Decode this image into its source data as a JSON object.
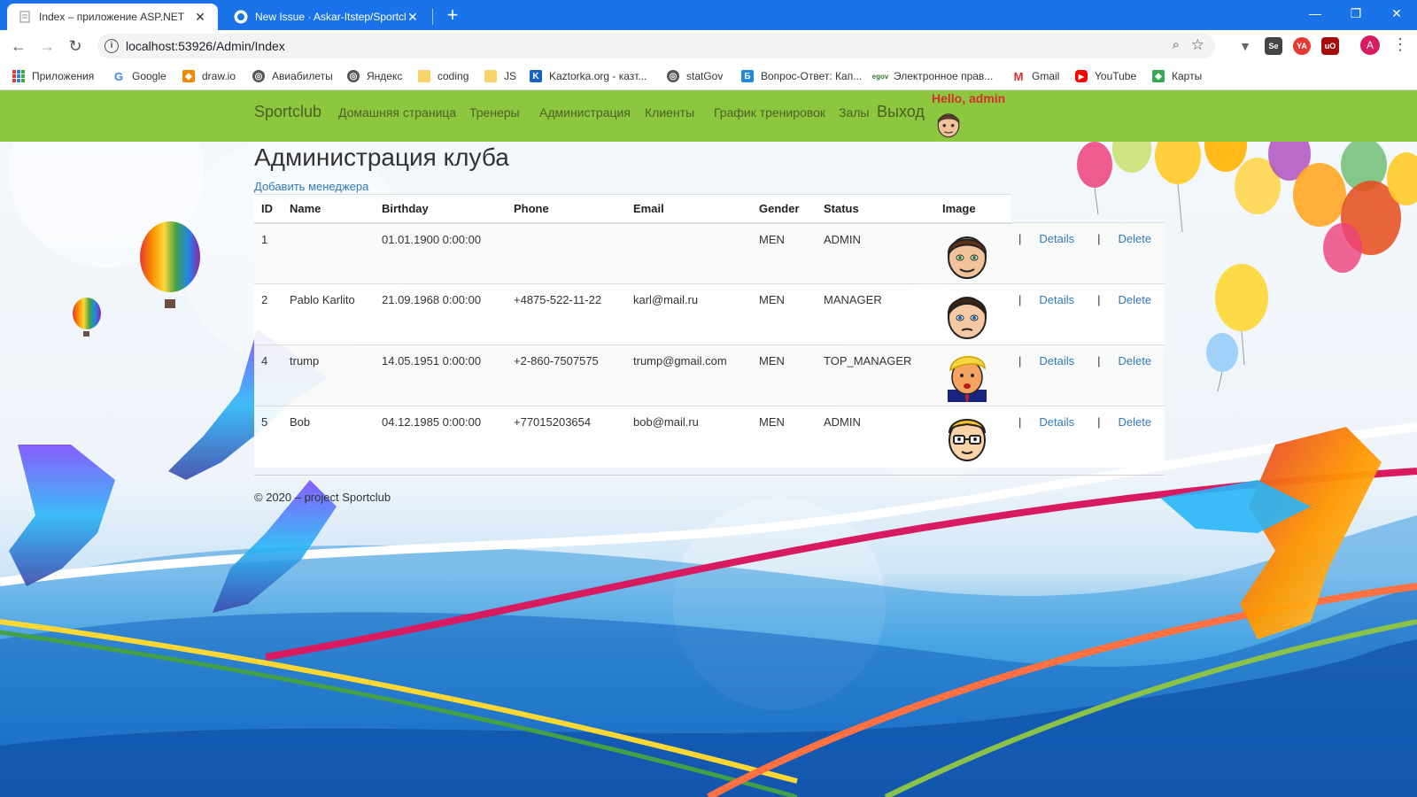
{
  "browser": {
    "tabs": [
      {
        "title": "Index – приложение ASP.NET",
        "active": true
      },
      {
        "title": "New Issue · Askar-Itstep/Sportclub",
        "active": false
      }
    ],
    "url": "localhost:53926/Admin/Index",
    "profile_initial": "A",
    "bookmarks": [
      {
        "label": "Приложения",
        "icon": "apps-grid-icon"
      },
      {
        "label": "Google",
        "icon": "google-icon"
      },
      {
        "label": "draw.io",
        "icon": "drawio-icon"
      },
      {
        "label": "Авиабилеты",
        "icon": "globe-icon"
      },
      {
        "label": "Яндекс",
        "icon": "globe-icon"
      },
      {
        "label": "coding",
        "icon": "folder-icon"
      },
      {
        "label": "JS",
        "icon": "folder-icon"
      },
      {
        "label": "Kaztorka.org - казт...",
        "icon": "kaztorka-icon"
      },
      {
        "label": "statGov",
        "icon": "globe-icon"
      },
      {
        "label": "Вопрос-Ответ: Кап...",
        "icon": "b-icon"
      },
      {
        "label": "Электронное прав...",
        "icon": "egov-icon"
      },
      {
        "label": "Gmail",
        "icon": "gmail-icon"
      },
      {
        "label": "YouTube",
        "icon": "youtube-icon"
      },
      {
        "label": "Карты",
        "icon": "maps-icon"
      }
    ]
  },
  "site": {
    "brand": "Sportclub",
    "nav": [
      "Домашняя страница",
      "Тренеры",
      "Администрация",
      "Клиенты",
      "График тренировок",
      "Залы"
    ],
    "logout": "Выход",
    "hello": "Hello, admin",
    "accent_color": "#8dc63f"
  },
  "main": {
    "heading": "Администрация клуба",
    "add_link": "Добавить менеджера",
    "columns": [
      "ID",
      "Name",
      "Birthday",
      "Phone",
      "Email",
      "Gender",
      "Status",
      "Image"
    ],
    "details_label": "Details",
    "delete_label": "Delete",
    "separator": "|",
    "rows": [
      {
        "id": "1",
        "name": "",
        "birthday": "01.01.1900 0:00:00",
        "phone": "",
        "email": "",
        "gender": "MEN",
        "status": "ADMIN",
        "avatar": "man-face-icon"
      },
      {
        "id": "2",
        "name": "Pablo Karlito",
        "birthday": "21.09.1968 0:00:00",
        "phone": "+4875-522-11-22",
        "email": "karl@mail.ru",
        "gender": "MEN",
        "status": "MANAGER",
        "avatar": "man-face-icon"
      },
      {
        "id": "4",
        "name": "trump",
        "birthday": "14.05.1951 0:00:00",
        "phone": "+2-860-7507575",
        "email": "trump@gmail.com",
        "gender": "MEN",
        "status": "TOP_MANAGER",
        "avatar": "trump-face-icon"
      },
      {
        "id": "5",
        "name": "Bob",
        "birthday": "04.12.1985 0:00:00",
        "phone": "+77015203654",
        "email": "bob@mail.ru",
        "gender": "MEN",
        "status": "ADMIN",
        "avatar": "nerd-face-icon"
      }
    ]
  },
  "footer": {
    "text": "© 2020 – project Sportclub"
  }
}
